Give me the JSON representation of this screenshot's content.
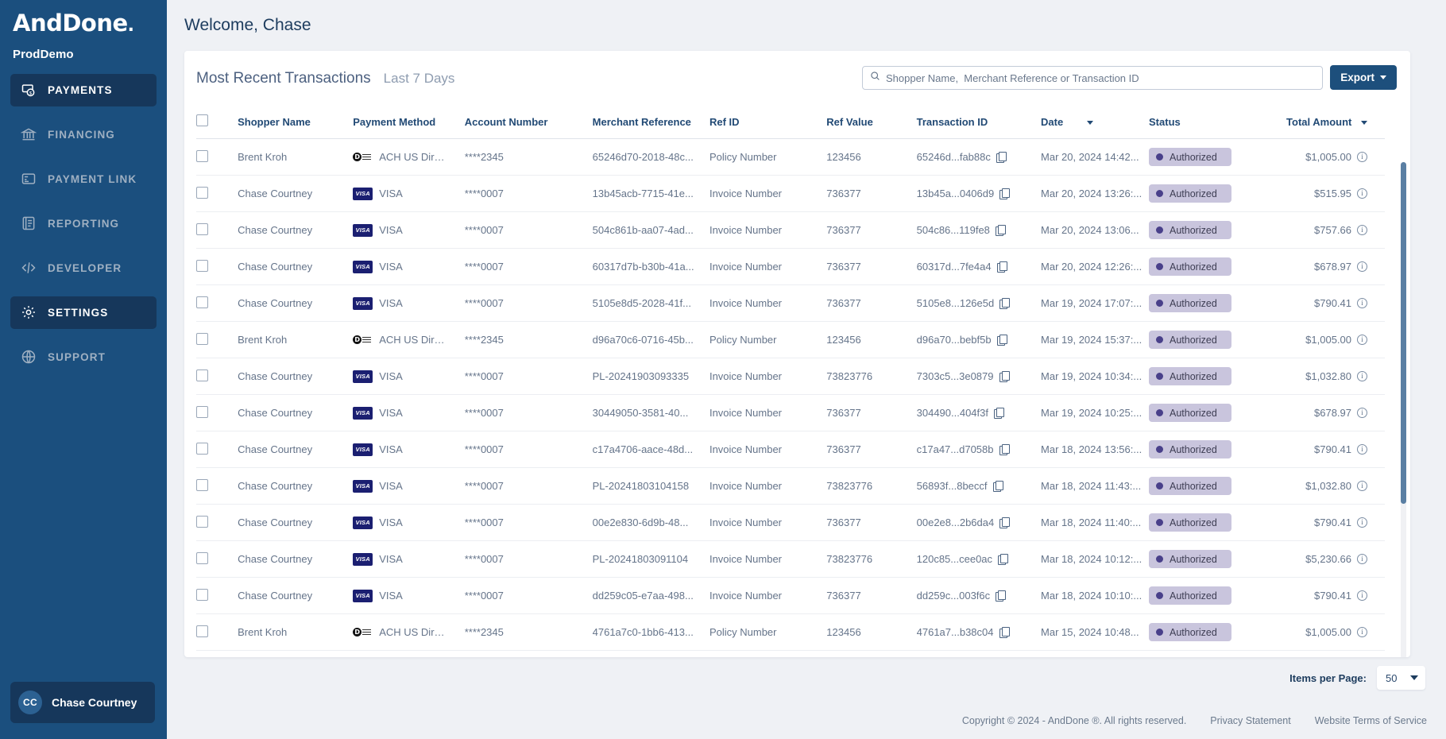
{
  "sidebar": {
    "logo": "AndDone",
    "logo_dot": ".",
    "tenant": "ProdDemo",
    "items": [
      {
        "label": "PAYMENTS",
        "icon": "payments-icon",
        "active": true
      },
      {
        "label": "FINANCING",
        "icon": "bank-icon",
        "active": false
      },
      {
        "label": "PAYMENT LINK",
        "icon": "card-link-icon",
        "active": false
      },
      {
        "label": "REPORTING",
        "icon": "report-icon",
        "active": false
      },
      {
        "label": "DEVELOPER",
        "icon": "code-icon",
        "active": false
      },
      {
        "label": "SETTINGS",
        "icon": "gear-icon",
        "active": true
      },
      {
        "label": "SUPPORT",
        "icon": "globe-icon",
        "active": false
      }
    ],
    "user": {
      "initials": "CC",
      "name": "Chase Courtney"
    }
  },
  "header": {
    "welcome": "Welcome, Chase"
  },
  "card": {
    "title": "Most Recent Transactions",
    "subtitle": "Last 7 Days",
    "search_placeholder": "Shopper Name,  Merchant Reference or Transaction ID",
    "search_value": "",
    "export_label": "Export"
  },
  "table": {
    "columns": [
      "Shopper Name",
      "Payment Method",
      "Account Number",
      "Merchant Reference",
      "Ref ID",
      "Ref Value",
      "Transaction ID",
      "Date",
      "Status",
      "Total Amount"
    ],
    "sorted_columns": [
      "Date",
      "Total Amount"
    ],
    "rows": [
      {
        "shopper": "Brent Kroh",
        "method": "ACH US Direc...",
        "brand": "ach",
        "account": "****2345",
        "merchant_ref": "65246d70-2018-48c...",
        "ref_id": "Policy Number",
        "ref_value": "123456",
        "txn_id": "65246d...fab88c",
        "date": "Mar 20, 2024 14:42...",
        "status": "Authorized",
        "amount": "$1,005.00"
      },
      {
        "shopper": "Chase Courtney",
        "method": "VISA",
        "brand": "visa",
        "account": "****0007",
        "merchant_ref": "13b45acb-7715-41e...",
        "ref_id": "Invoice Number",
        "ref_value": "736377",
        "txn_id": "13b45a...0406d9",
        "date": "Mar 20, 2024 13:26:...",
        "status": "Authorized",
        "amount": "$515.95"
      },
      {
        "shopper": "Chase Courtney",
        "method": "VISA",
        "brand": "visa",
        "account": "****0007",
        "merchant_ref": "504c861b-aa07-4ad...",
        "ref_id": "Invoice Number",
        "ref_value": "736377",
        "txn_id": "504c86...119fe8",
        "date": "Mar 20, 2024 13:06...",
        "status": "Authorized",
        "amount": "$757.66"
      },
      {
        "shopper": "Chase Courtney",
        "method": "VISA",
        "brand": "visa",
        "account": "****0007",
        "merchant_ref": "60317d7b-b30b-41a...",
        "ref_id": "Invoice Number",
        "ref_value": "736377",
        "txn_id": "60317d...7fe4a4",
        "date": "Mar 20, 2024 12:26:...",
        "status": "Authorized",
        "amount": "$678.97"
      },
      {
        "shopper": "Chase Courtney",
        "method": "VISA",
        "brand": "visa",
        "account": "****0007",
        "merchant_ref": "5105e8d5-2028-41f...",
        "ref_id": "Invoice Number",
        "ref_value": "736377",
        "txn_id": "5105e8...126e5d",
        "date": "Mar 19, 2024 17:07:...",
        "status": "Authorized",
        "amount": "$790.41"
      },
      {
        "shopper": "Brent Kroh",
        "method": "ACH US Direc...",
        "brand": "ach",
        "account": "****2345",
        "merchant_ref": "d96a70c6-0716-45b...",
        "ref_id": "Policy Number",
        "ref_value": "123456",
        "txn_id": "d96a70...bebf5b",
        "date": "Mar 19, 2024 15:37:...",
        "status": "Authorized",
        "amount": "$1,005.00"
      },
      {
        "shopper": "Chase Courtney",
        "method": "VISA",
        "brand": "visa",
        "account": "****0007",
        "merchant_ref": "PL-20241903093335",
        "ref_id": "Invoice Number",
        "ref_value": "73823776",
        "txn_id": "7303c5...3e0879",
        "date": "Mar 19, 2024 10:34:...",
        "status": "Authorized",
        "amount": "$1,032.80"
      },
      {
        "shopper": "Chase Courtney",
        "method": "VISA",
        "brand": "visa",
        "account": "****0007",
        "merchant_ref": "30449050-3581-40...",
        "ref_id": "Invoice Number",
        "ref_value": "736377",
        "txn_id": "304490...404f3f",
        "date": "Mar 19, 2024 10:25:...",
        "status": "Authorized",
        "amount": "$678.97"
      },
      {
        "shopper": "Chase Courtney",
        "method": "VISA",
        "brand": "visa",
        "account": "****0007",
        "merchant_ref": "c17a4706-aace-48d...",
        "ref_id": "Invoice Number",
        "ref_value": "736377",
        "txn_id": "c17a47...d7058b",
        "date": "Mar 18, 2024 13:56:...",
        "status": "Authorized",
        "amount": "$790.41"
      },
      {
        "shopper": "Chase Courtney",
        "method": "VISA",
        "brand": "visa",
        "account": "****0007",
        "merchant_ref": "PL-20241803104158",
        "ref_id": "Invoice Number",
        "ref_value": "73823776",
        "txn_id": "56893f...8beccf",
        "date": "Mar 18, 2024 11:43:...",
        "status": "Authorized",
        "amount": "$1,032.80"
      },
      {
        "shopper": "Chase Courtney",
        "method": "VISA",
        "brand": "visa",
        "account": "****0007",
        "merchant_ref": "00e2e830-6d9b-48...",
        "ref_id": "Invoice Number",
        "ref_value": "736377",
        "txn_id": "00e2e8...2b6da4",
        "date": "Mar 18, 2024 11:40:...",
        "status": "Authorized",
        "amount": "$790.41"
      },
      {
        "shopper": "Chase Courtney",
        "method": "VISA",
        "brand": "visa",
        "account": "****0007",
        "merchant_ref": "PL-20241803091104",
        "ref_id": "Invoice Number",
        "ref_value": "73823776",
        "txn_id": "120c85...cee0ac",
        "date": "Mar 18, 2024 10:12:...",
        "status": "Authorized",
        "amount": "$5,230.66"
      },
      {
        "shopper": "Chase Courtney",
        "method": "VISA",
        "brand": "visa",
        "account": "****0007",
        "merchant_ref": "dd259c05-e7aa-498...",
        "ref_id": "Invoice Number",
        "ref_value": "736377",
        "txn_id": "dd259c...003f6c",
        "date": "Mar 18, 2024 10:10:...",
        "status": "Authorized",
        "amount": "$790.41"
      },
      {
        "shopper": "Brent Kroh",
        "method": "ACH US Direc...",
        "brand": "ach",
        "account": "****2345",
        "merchant_ref": "4761a7c0-1bb6-413...",
        "ref_id": "Policy Number",
        "ref_value": "123456",
        "txn_id": "4761a7...b38c04",
        "date": "Mar 15, 2024 10:48...",
        "status": "Authorized",
        "amount": "$1,005.00"
      }
    ]
  },
  "pagination": {
    "label": "Items per Page:",
    "value": "50"
  },
  "footer": {
    "copyright": "Copyright © 2024 - AndDone ®. All rights reserved.",
    "privacy": "Privacy Statement",
    "terms": "Website Terms of Service"
  },
  "colors": {
    "sidebar_bg": "#1b4f7e",
    "sidebar_active": "#16375b",
    "accent": "#1d4f7c",
    "status_badge_bg": "#c9c5dd",
    "status_dot": "#49408a",
    "page_bg": "#eff1f5"
  }
}
